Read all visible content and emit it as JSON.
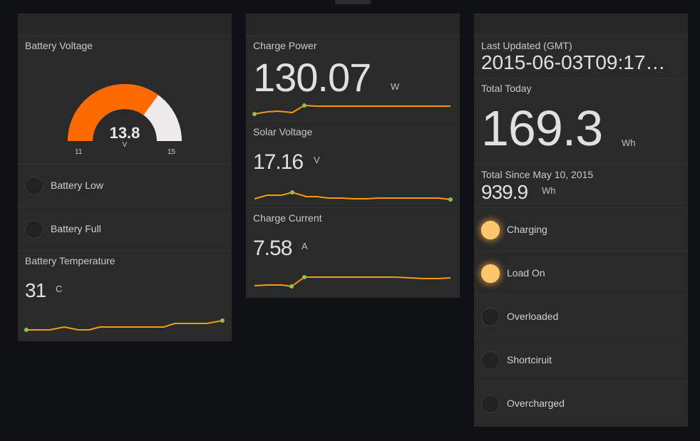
{
  "battery_voltage": {
    "title": "Battery Voltage",
    "value": "13.8",
    "unit": "V",
    "min": "11",
    "max": "15",
    "fraction": 0.7
  },
  "indicators_left": [
    {
      "label": "Battery Low",
      "on": false
    },
    {
      "label": "Battery Full",
      "on": false
    }
  ],
  "battery_temperature": {
    "title": "Battery Temperature",
    "value": "31",
    "unit": "C"
  },
  "charge_power": {
    "title": "Charge Power",
    "value": "130.07",
    "unit": "W"
  },
  "solar_voltage": {
    "title": "Solar Voltage",
    "value": "17.16",
    "unit": "V"
  },
  "charge_current": {
    "title": "Charge Current",
    "value": "7.58",
    "unit": "A"
  },
  "last_updated": {
    "title": "Last Updated (GMT)",
    "value": "2015-06-03T09:17…"
  },
  "total_today": {
    "title": "Total Today",
    "value": "169.3",
    "unit": "Wh"
  },
  "total_since": {
    "title": "Total Since May 10, 2015",
    "value": "939.9",
    "unit": "Wh"
  },
  "indicators_right": [
    {
      "label": "Charging",
      "on": true
    },
    {
      "label": "Load On",
      "on": true
    },
    {
      "label": "Overloaded",
      "on": false
    },
    {
      "label": "Shortciruit",
      "on": false
    },
    {
      "label": "Overcharged",
      "on": false
    }
  ],
  "colors": {
    "gauge_fill": "#ff6a00",
    "gauge_track": "#efeaec",
    "sparkline": "#f39c12",
    "sparkpoint": "#8bc34a",
    "led_on": "#ffc56b"
  }
}
